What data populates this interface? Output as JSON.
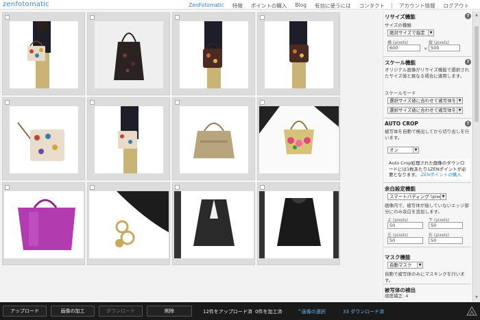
{
  "header": {
    "logo": "zenfotomatic",
    "nav": [
      "ZenFotomatic",
      "特徴",
      "ポイントの購入",
      "Blog",
      "有効に使うには",
      "コンタクト",
      "アカウント情報",
      "ログアウト"
    ]
  },
  "panel": {
    "resize": {
      "title": "リサイズ機能",
      "type_label": "サイズの種類",
      "type_value": "絶対サイズで指定",
      "width_label": "横 (pixels)",
      "width_value": "600",
      "height_label": "縦 (pixels)",
      "height_value": "500",
      "times": "×"
    },
    "scale": {
      "title": "スケール機能",
      "desc": "オリジナル画像がリサイズ機能で選択されたサイズ値と異なる場合に適用します。",
      "mode_label": "スケールモード",
      "mode1": "選択サイズ値に合わせて被写体を",
      "mode2": "選択サイズ値に合わせて被写体を"
    },
    "autocrop": {
      "title": "AUTO CROP",
      "desc": "被写体を自動で検出してから切り出しを行います。",
      "value": "オン",
      "note": "Auto Crop処理された画像のダウンロードには1枚あたり1ZENポイントが必要となります。",
      "note_link": "ZENポイントの購入"
    },
    "margin": {
      "title": "余白設定機能",
      "mode": "スマートパディング (pixels)",
      "desc": "画像内で、被写体が接していないエッジ部分にのみ余白を追加します。",
      "top_label": "上 (pixels)",
      "top_value": "50",
      "bottom_label": "下 (pixels)",
      "bottom_value": "50",
      "left_label": "左 (pixels)",
      "left_value": "50",
      "right_label": "右 (pixels)",
      "right_value": "50"
    },
    "mask": {
      "title": "マスク機能",
      "value": "自動マスク",
      "desc": "自動で被写体のみにマスキングを行います。"
    },
    "detect": {
      "title": "被写体の検出",
      "value": "感度補正: 4"
    }
  },
  "bottom": {
    "upload": "アップロード",
    "process": "画像の加工",
    "download": "ダウンロード",
    "delete": "削除",
    "uploaded": "12件をアップロード済",
    "processed": "0件を加工済",
    "select": "^画像の選択",
    "downloaded": "33 ダウンロード済"
  },
  "colors": {
    "accent": "#2a8ad0",
    "purple_bag": "#b23bb0",
    "dark_bar": "#1a1a1a"
  },
  "thumbnails": [
    "woman-bag-1",
    "handbag-dark",
    "woman-bag-2",
    "woman-bag-3",
    "handbag-floral",
    "woman-bag-4",
    "tote-beige",
    "straw-bag-flowers",
    "purple-bag",
    "bag-charm",
    "black-jacket",
    "black-coat"
  ]
}
